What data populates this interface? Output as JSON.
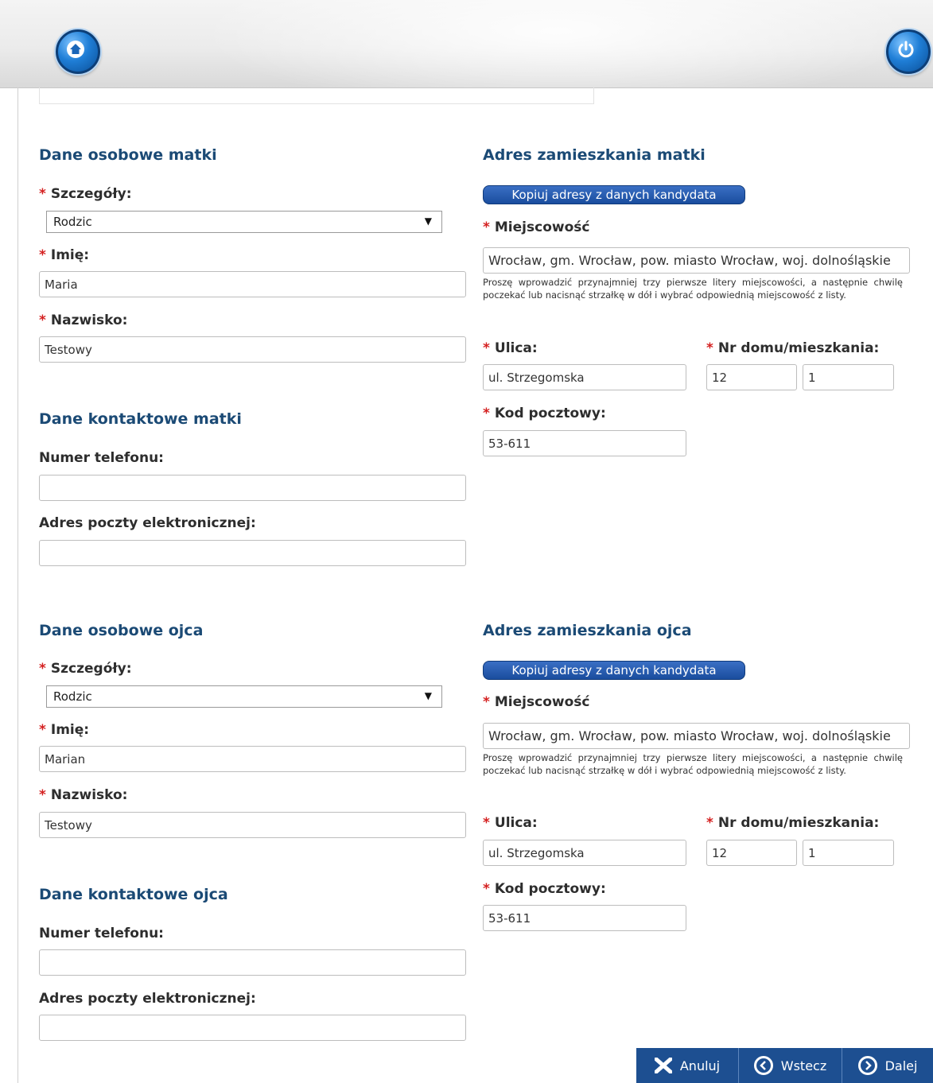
{
  "header": {
    "home_icon": "home-icon",
    "power_icon": "power-icon"
  },
  "colors": {
    "section_title": "#1b4a75",
    "required": "#d42020",
    "button_blue": "#1d4f91"
  },
  "common": {
    "required_mark": "*",
    "details_label": "Szczegóły:",
    "first_name_label": "Imię:",
    "last_name_label": "Nazwisko:",
    "phone_label": "Numer telefonu:",
    "email_label": "Adres poczty elektronicznej:",
    "copy_button": "Kopiuj adresy z danych kandydata",
    "locality_label": "Miejscowość",
    "locality_hint": "Proszę wprowadzić przynajmniej trzy pierwsze litery miejscowości, a następnie chwilę poczekać lub nacisnąć strzałkę w dół i wybrać odpowiednią miejscowość z listy.",
    "street_label": "Ulica:",
    "house_label": "Nr domu/mieszkania:",
    "postal_label": "Kod pocztowy:"
  },
  "mother": {
    "personal_title": "Dane osobowe matki",
    "contact_title": "Dane kontaktowe matki",
    "address_title": "Adres zamieszkania matki",
    "details_value": "Rodzic",
    "first_name": "Maria",
    "last_name": "Testowy",
    "phone": "",
    "email": "",
    "locality": "Wrocław, gm. Wrocław, pow. miasto Wrocław, woj. dolnośląskie",
    "street": "ul. Strzegomska",
    "house_number": "12",
    "apartment_number": "1",
    "postal_code": "53-611"
  },
  "father": {
    "personal_title": "Dane osobowe ojca",
    "contact_title": "Dane kontaktowe ojca",
    "address_title": "Adres zamieszkania ojca",
    "details_value": "Rodzic",
    "first_name": "Marian",
    "last_name": "Testowy",
    "phone": "",
    "email": "",
    "locality": "Wrocław, gm. Wrocław, pow. miasto Wrocław, woj. dolnośląskie",
    "street": "ul. Strzegomska",
    "house_number": "12",
    "apartment_number": "1",
    "postal_code": "53-611"
  },
  "footer": {
    "cancel": "Anuluj",
    "back": "Wstecz",
    "next": "Dalej",
    "cancel_icon": "close-icon",
    "back_icon": "chevron-left-circle-icon",
    "next_icon": "chevron-right-circle-icon"
  }
}
